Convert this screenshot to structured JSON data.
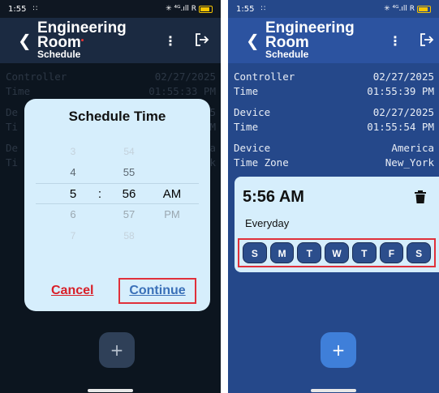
{
  "left": {
    "status": {
      "time": "1:55",
      "grid": "∷",
      "signal": "✳ ⁴ᴳ.ıll R"
    },
    "header": {
      "title_line1": "Engineering",
      "title_line2": "Room",
      "subtitle": "Schedule",
      "menu": "⋮"
    },
    "info_rows": [
      {
        "label": "Controller",
        "value": "02/27/2025"
      },
      {
        "label": "Time",
        "value": "01:55:33 PM"
      },
      {
        "label": "De",
        "value": "25"
      },
      {
        "label": "Ti",
        "value": "PM"
      },
      {
        "label": "De",
        "value": "ca"
      },
      {
        "label": "Ti",
        "value": "rk"
      }
    ],
    "dialog": {
      "title": "Schedule Time",
      "rows": [
        {
          "h": "3",
          "m": "54",
          "ap": ""
        },
        {
          "h": "4",
          "m": "55",
          "ap": ""
        },
        {
          "h": "5",
          "m": "56",
          "ap": "AM"
        },
        {
          "h": "6",
          "m": "57",
          "ap": "PM"
        },
        {
          "h": "7",
          "m": "58",
          "ap": ""
        }
      ],
      "separator": ":",
      "cancel": "Cancel",
      "continue": "Continue"
    },
    "fab": "+"
  },
  "right": {
    "status": {
      "time": "1:55",
      "grid": "∷",
      "signal": "✳ ⁴ᴳ.ıll R"
    },
    "header": {
      "title_line1": "Engineering",
      "title_line2": "Room",
      "subtitle": "Schedule",
      "menu": "⋮"
    },
    "info_rows": [
      {
        "label": "Controller",
        "value": "02/27/2025"
      },
      {
        "label": "Time",
        "value": "01:55:39 PM"
      },
      {
        "label": "Device",
        "value": "02/27/2025"
      },
      {
        "label": "Time",
        "value": "01:55:54 PM"
      },
      {
        "label": "Device",
        "value": "America"
      },
      {
        "label": "Time Zone",
        "value": "New_York"
      }
    ],
    "card": {
      "time": "5:56 AM",
      "repeat": "Everyday",
      "days": [
        "S",
        "M",
        "T",
        "W",
        "T",
        "F",
        "S"
      ]
    },
    "fab": "+"
  },
  "colors": {
    "accent_red": "#e0303a",
    "card_bg": "#d6eefc",
    "header_blue": "#2c53a0"
  },
  "icons": [
    "back-arrow-icon",
    "kebab-menu-icon",
    "logout-icon",
    "trash-icon",
    "plus-icon",
    "battery-icon"
  ]
}
